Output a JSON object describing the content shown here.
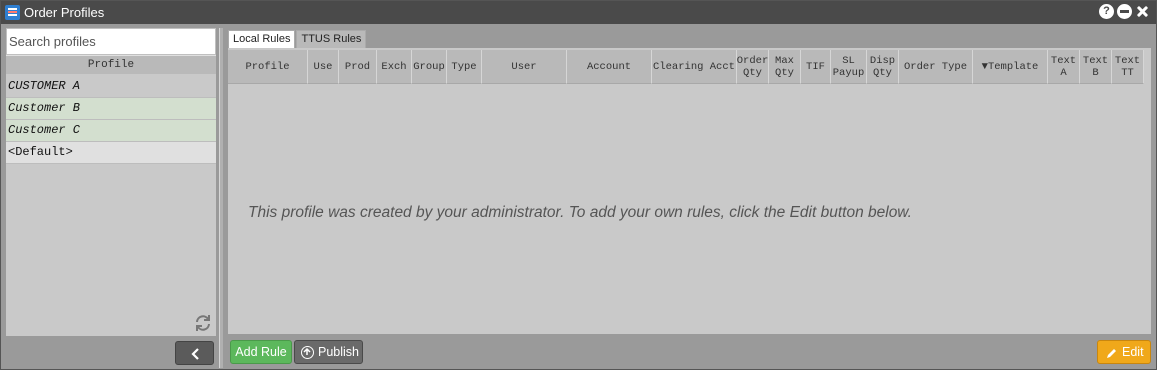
{
  "window": {
    "title": "Order Profiles"
  },
  "sidebar": {
    "search_placeholder": "Search profiles",
    "column_header": "Profile",
    "profiles": [
      {
        "name": "CUSTOMER A"
      },
      {
        "name": "Customer B"
      },
      {
        "name": "Customer C"
      },
      {
        "name": "<Default>"
      }
    ]
  },
  "tabs": [
    {
      "label": "Local Rules",
      "active": true
    },
    {
      "label": "TTUS Rules",
      "active": false
    }
  ],
  "table": {
    "columns": [
      {
        "line1": "Profile",
        "line2": ""
      },
      {
        "line1": "Use",
        "line2": ""
      },
      {
        "line1": "Prod",
        "line2": ""
      },
      {
        "line1": "Exch",
        "line2": ""
      },
      {
        "line1": "Group",
        "line2": ""
      },
      {
        "line1": "Type",
        "line2": ""
      },
      {
        "line1": "User",
        "line2": ""
      },
      {
        "line1": "Account",
        "line2": ""
      },
      {
        "line1": "Clearing Acct",
        "line2": ""
      },
      {
        "line1": "Order",
        "line2": "Qty"
      },
      {
        "line1": "Max",
        "line2": "Qty"
      },
      {
        "line1": "TIF",
        "line2": ""
      },
      {
        "line1": "SL",
        "line2": "Payup"
      },
      {
        "line1": "Disp",
        "line2": "Qty"
      },
      {
        "line1": "Order Type",
        "line2": ""
      },
      {
        "line1": "▼Template",
        "line2": ""
      },
      {
        "line1": "Text",
        "line2": "A"
      },
      {
        "line1": "Text",
        "line2": "B"
      },
      {
        "line1": "Text",
        "line2": "TT"
      }
    ],
    "empty_message": "This profile was created by your administrator. To add your own rules, click the Edit button below."
  },
  "footer": {
    "add_rule_label": "Add Rule",
    "publish_label": "Publish",
    "edit_label": "Edit"
  },
  "colors": {
    "accent_green": "#5cb85c",
    "accent_orange": "#f0a81a",
    "title_bar": "#4a4a4a",
    "selected_profile_bg": "#d3dfcf"
  },
  "icons": {
    "app": "order-profiles-icon",
    "help": "help-icon",
    "minimize": "minimize-icon",
    "close": "close-icon",
    "refresh": "refresh-icon",
    "collapse": "chevron-left-icon",
    "publish": "upload-circle-icon",
    "edit": "pencil-icon"
  }
}
